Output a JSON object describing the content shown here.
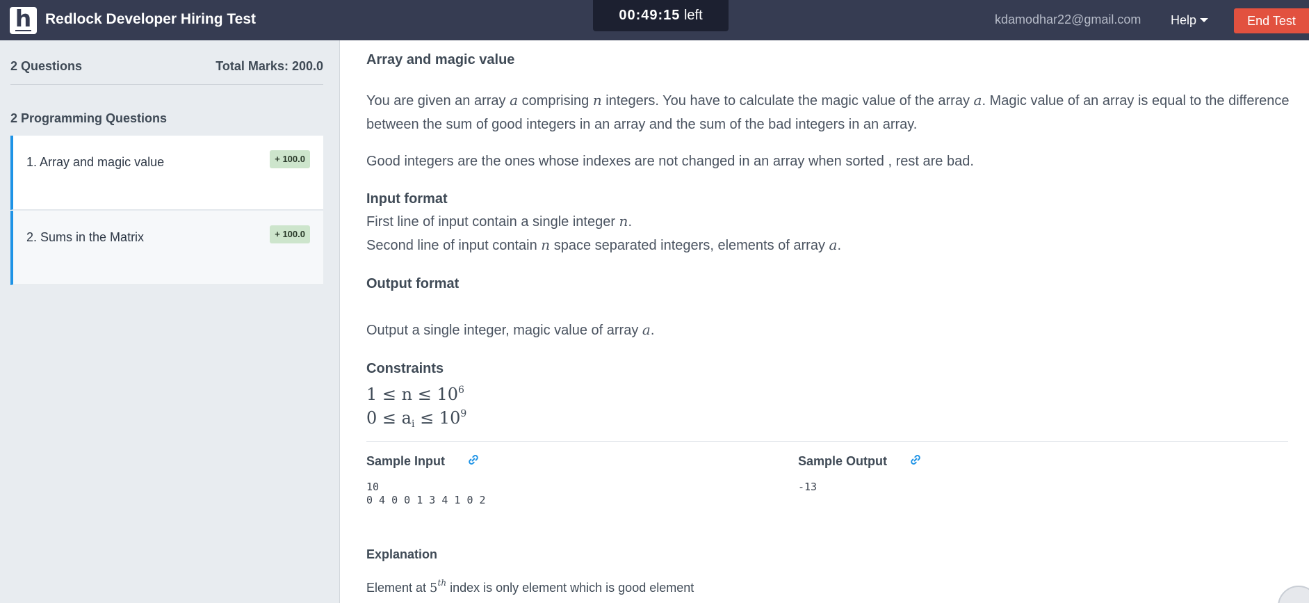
{
  "header": {
    "logo_letter": "h",
    "title": "Redlock Developer Hiring Test",
    "timer_value": "00:49:15",
    "timer_suffix": "left",
    "user_email": "kdamodhar22@gmail.com",
    "help_label": "Help",
    "end_test_label": "End Test"
  },
  "sidebar": {
    "questions_count": "2 Questions",
    "total_marks": "Total Marks: 200.0",
    "section_title": "2 Programming Questions",
    "items": [
      {
        "label": "1. Array and magic value",
        "marks": "+ 100.0"
      },
      {
        "label": "2. Sums in the Matrix",
        "marks": "+ 100.0"
      }
    ]
  },
  "question": {
    "title": "Array and magic value",
    "p1_a": "You are given an array ",
    "p1_var_a": "a",
    "p1_b": " comprising ",
    "p1_var_n": "n",
    "p1_c": " integers. You have to calculate the magic value of the array ",
    "p1_var_a2": "a",
    "p1_d": ". Magic value of an array is equal to the difference between the sum of good integers in an array and the sum of the bad integers in an array.",
    "p2": "Good integers are the ones whose indexes are not changed in an array when sorted , rest are bad.",
    "input_heading": "Input format",
    "input_line1_a": "First line of input contain a single integer ",
    "input_line1_var": "n",
    "input_line1_b": ".",
    "input_line2_a": "Second line of input contain ",
    "input_line2_var": "n",
    "input_line2_b": " space separated integers, elements of array ",
    "input_line2_var2": "a",
    "input_line2_c": ".",
    "output_heading": "Output format",
    "output_a": "Output a single integer, magic value of array ",
    "output_var": "a",
    "output_b": ".",
    "constraints_heading": "Constraints",
    "constraint1": "1 ≤ n ≤ 10",
    "constraint1_exp": "6",
    "constraint2_a": "0 ≤ a",
    "constraint2_sub": "i",
    "constraint2_b": " ≤ 10",
    "constraint2_exp": "9",
    "sample_input_label": "Sample Input",
    "sample_input_text": "10\n0 4 0 0 1 3 4 1 0 2",
    "sample_output_label": "Sample Output",
    "sample_output_text": "-13",
    "explanation_heading": "Explanation",
    "explanation_a": "Element at ",
    "explanation_num": "5",
    "explanation_sup": "th",
    "explanation_b": " index is only element which is good element"
  },
  "icons": {
    "logo": "hackerearth-logo",
    "help_caret": "chevron-down-icon",
    "sample_link": "link-icon",
    "chat": "chat-icon"
  },
  "colors": {
    "topbar": "#363c52",
    "end_test": "#e2513f",
    "active_accent": "#1e93e6",
    "marks_badge": "#cde5cc"
  }
}
